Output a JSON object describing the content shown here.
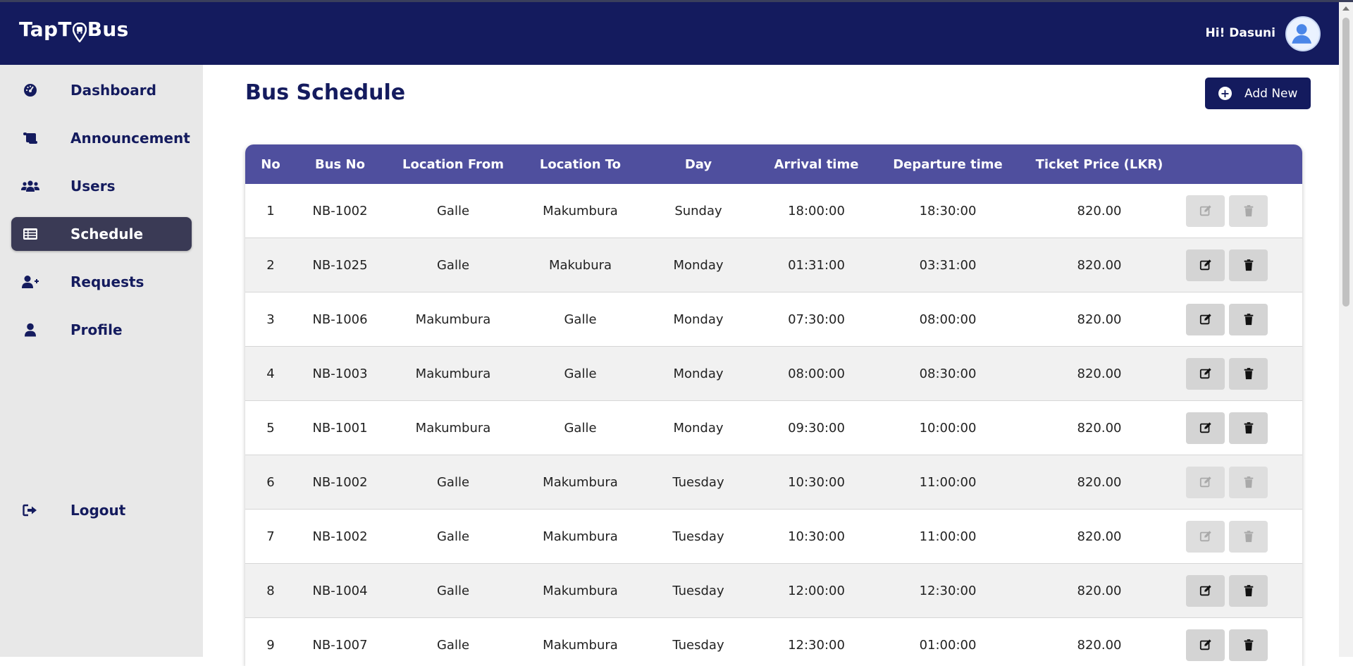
{
  "header": {
    "logo_text_left": "TapT",
    "logo_text_right": "Bus",
    "greeting": "Hi! Dasuni"
  },
  "sidebar": {
    "items": [
      {
        "label": "Dashboard",
        "icon": "dashboard-gauge-icon"
      },
      {
        "label": "Announcement",
        "icon": "announcement-scroll-icon"
      },
      {
        "label": "Users",
        "icon": "users-icon"
      },
      {
        "label": "Schedule",
        "icon": "schedule-table-icon",
        "active": true
      },
      {
        "label": "Requests",
        "icon": "user-plus-icon"
      },
      {
        "label": "Profile",
        "icon": "user-icon"
      }
    ],
    "logout_label": "Logout"
  },
  "main": {
    "title": "Bus Schedule",
    "add_button_label": "Add New"
  },
  "table": {
    "columns": [
      "No",
      "Bus No",
      "Location From",
      "Location To",
      "Day",
      "Arrival time",
      "Departure time",
      "Ticket Price (LKR)"
    ],
    "rows": [
      {
        "no": "1",
        "bus": "NB-1002",
        "from": "Galle",
        "to": "Makumbura",
        "day": "Sunday",
        "arrival": "18:00:00",
        "departure": "18:30:00",
        "price": "820.00",
        "actions_enabled": false
      },
      {
        "no": "2",
        "bus": "NB-1025",
        "from": "Galle",
        "to": "Makubura",
        "day": "Monday",
        "arrival": "01:31:00",
        "departure": "03:31:00",
        "price": "820.00",
        "actions_enabled": true
      },
      {
        "no": "3",
        "bus": "NB-1006",
        "from": "Makumbura",
        "to": "Galle",
        "day": "Monday",
        "arrival": "07:30:00",
        "departure": "08:00:00",
        "price": "820.00",
        "actions_enabled": true
      },
      {
        "no": "4",
        "bus": "NB-1003",
        "from": "Makumbura",
        "to": "Galle",
        "day": "Monday",
        "arrival": "08:00:00",
        "departure": "08:30:00",
        "price": "820.00",
        "actions_enabled": true
      },
      {
        "no": "5",
        "bus": "NB-1001",
        "from": "Makumbura",
        "to": "Galle",
        "day": "Monday",
        "arrival": "09:30:00",
        "departure": "10:00:00",
        "price": "820.00",
        "actions_enabled": true
      },
      {
        "no": "6",
        "bus": "NB-1002",
        "from": "Galle",
        "to": "Makumbura",
        "day": "Tuesday",
        "arrival": "10:30:00",
        "departure": "11:00:00",
        "price": "820.00",
        "actions_enabled": false
      },
      {
        "no": "7",
        "bus": "NB-1002",
        "from": "Galle",
        "to": "Makumbura",
        "day": "Tuesday",
        "arrival": "10:30:00",
        "departure": "11:00:00",
        "price": "820.00",
        "actions_enabled": false
      },
      {
        "no": "8",
        "bus": "NB-1004",
        "from": "Galle",
        "to": "Makumbura",
        "day": "Tuesday",
        "arrival": "12:00:00",
        "departure": "12:30:00",
        "price": "820.00",
        "actions_enabled": true
      },
      {
        "no": "9",
        "bus": "NB-1007",
        "from": "Galle",
        "to": "Makumbura",
        "day": "Tuesday",
        "arrival": "12:30:00",
        "departure": "01:00:00",
        "price": "820.00",
        "actions_enabled": true
      }
    ]
  },
  "colors": {
    "header_bg": "#141b5e",
    "table_header_bg": "#4f4f9e",
    "sidebar_bg": "#e8e8e8",
    "active_nav_bg": "#3a3a55"
  }
}
